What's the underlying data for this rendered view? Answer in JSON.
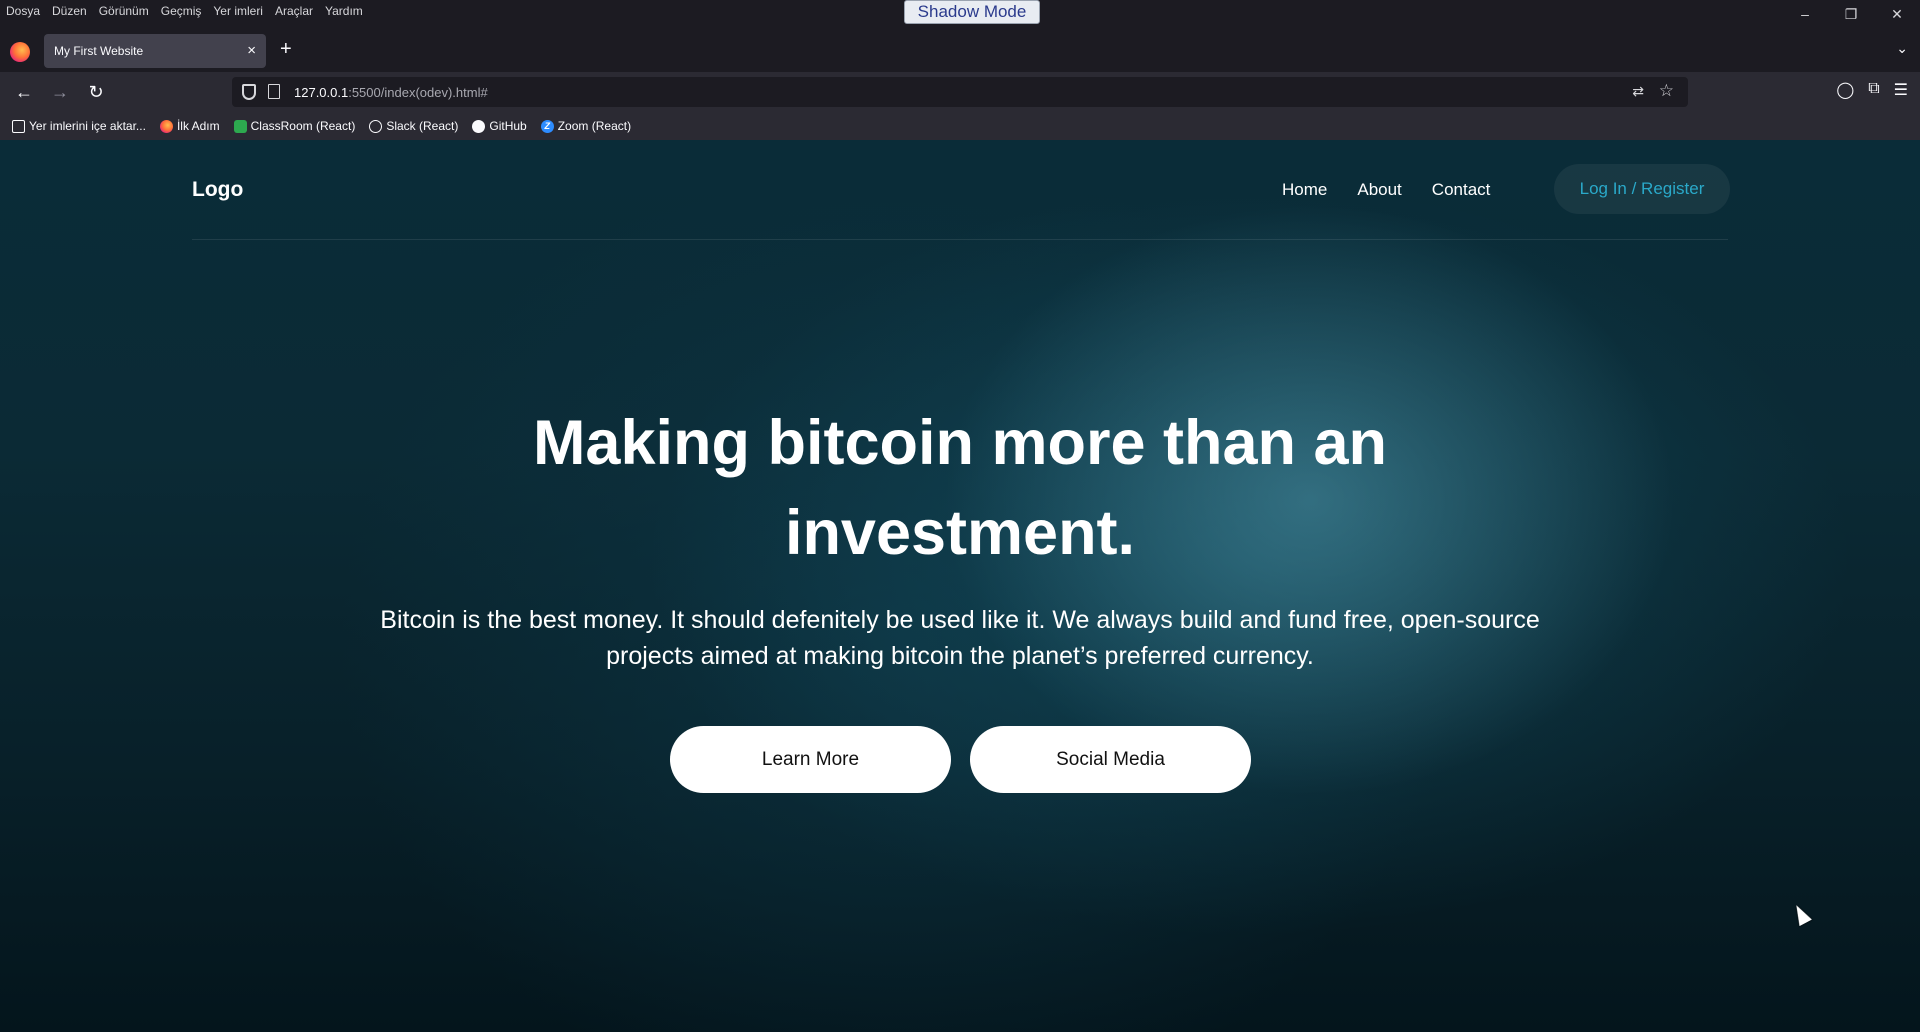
{
  "menubar": {
    "items": [
      "Dosya",
      "Düzen",
      "Görünüm",
      "Geçmiş",
      "Yer imleri",
      "Araçlar",
      "Yardım"
    ]
  },
  "shadow_mode": "Shadow Mode",
  "tab": {
    "title": "My First Website",
    "close": "×"
  },
  "address": {
    "host": "127.0.0.1",
    "path": ":5500/index(odev).html#"
  },
  "bookmarks": [
    {
      "label": "Yer imlerini içe aktar...",
      "icon": "import-icon"
    },
    {
      "label": "İlk Adım",
      "icon": "firefox-icon"
    },
    {
      "label": "ClassRoom (React)",
      "icon": "classroom-icon"
    },
    {
      "label": "Slack (React)",
      "icon": "globe-icon"
    },
    {
      "label": "GitHub",
      "icon": "github-icon"
    },
    {
      "label": "Zoom (React)",
      "icon": "zoom-icon"
    }
  ],
  "site": {
    "logo": "Logo",
    "nav": [
      "Home",
      "About",
      "Contact"
    ],
    "auth": "Log In / Register",
    "hero_title": "Making bitcoin more than an investment.",
    "hero_text": "Bitcoin is the best money. It should defenitely be used like it. We always build and fund free, open-source projects aimed at making bitcoin the planet’s preferred currency.",
    "cta_learn": "Learn More",
    "cta_social": "Social Media"
  },
  "colors": {
    "accent": "#2aa9c9",
    "hero_bg": "#0a2c38"
  }
}
